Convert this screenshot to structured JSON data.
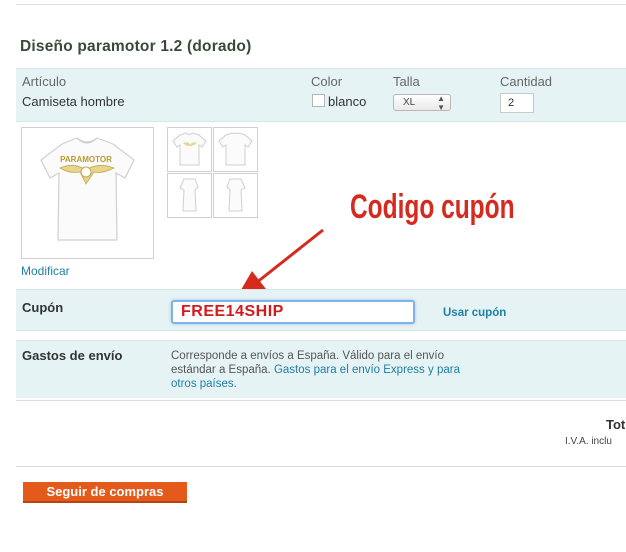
{
  "product": {
    "title": "Diseño paramotor 1.2 (dorado)",
    "headers": {
      "article": "Artículo",
      "color": "Color",
      "size": "Talla",
      "quantity": "Cantidad"
    },
    "article_name": "Camiseta hombre",
    "color_value": "blanco",
    "size_value": "XL",
    "quantity_value": "2",
    "shirt_print": "PARAMOTOR",
    "modify_link": "Modificar"
  },
  "coupon": {
    "label": "Cupón",
    "code": "FREE14SHIP",
    "apply_link": "Usar cupón",
    "annotation": "Codigo cupón"
  },
  "shipping": {
    "label": "Gastos de envío",
    "text": "Corresponde a envíos a España. Válido para el envío estándar a España.",
    "link_text": "Gastos para el envío Express y para otros países."
  },
  "totals": {
    "label_partial": "Tot",
    "tax_partial": "I.V.A. inclu"
  },
  "continue_button": "Seguir de compras",
  "colors": {
    "accent_orange": "#e45a1a",
    "annotation_red": "#d62a1e",
    "link_blue": "#1f7fa3",
    "band": "#e6f3f4"
  }
}
